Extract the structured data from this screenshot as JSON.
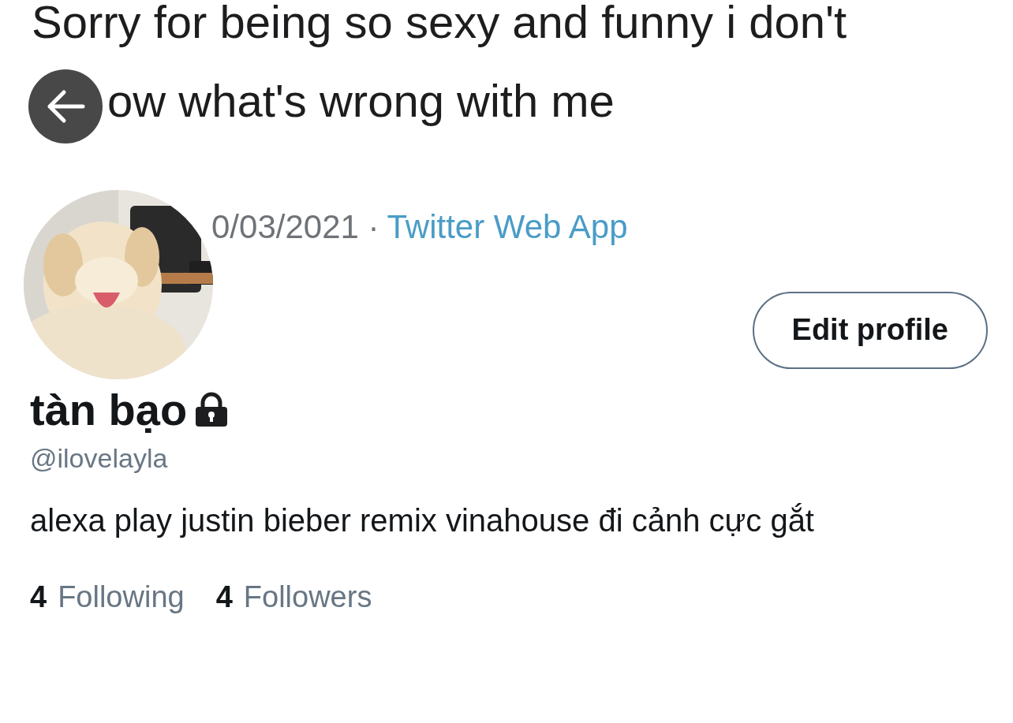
{
  "header": {
    "tweet_lines": [
      "Sorry for being so sexy and funny i don't",
      "ow what's wrong with me"
    ],
    "date": "0/03/2021 ·",
    "source": "Twitter Web App"
  },
  "edit_button": {
    "label": "Edit profile"
  },
  "profile": {
    "name": "tàn bạo",
    "locked": true,
    "handle": "@ilovelayla",
    "bio": "alexa play justin bieber remix vinahouse đi cảnh cực gắt"
  },
  "stats": [
    {
      "count": "4",
      "label": "Following"
    },
    {
      "count": "4",
      "label": "Followers"
    }
  ]
}
